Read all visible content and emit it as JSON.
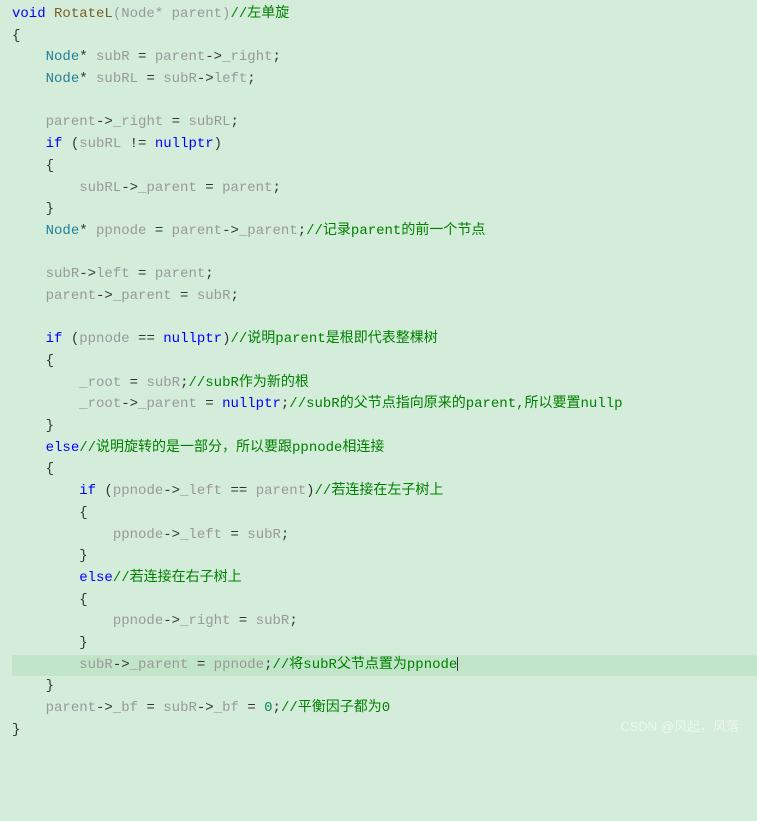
{
  "watermark": "CSDN @风起，风落",
  "tokens": {
    "void": "void",
    "Node": "Node",
    "if": "if",
    "else": "else",
    "nullptr": "nullptr"
  },
  "code": {
    "l1_func": "RotateL",
    "l1_params": "(Node* parent)",
    "l1_comment": "//左单旋",
    "l2": "{",
    "l3_prefix": "    ",
    "l3_type": "Node",
    "l3_star": "* ",
    "l3_var": "subR",
    "l3_eq": " = ",
    "l3_rhs1": "parent",
    "l3_arr": "->",
    "l3_rhs2": "_right",
    "l3_semi": ";",
    "l4_var": "subRL",
    "l4_rhs1": "subR",
    "l4_rhs2": "left",
    "l6_lhs1": "parent",
    "l6_lhs2": "_right",
    "l6_rhs": "subRL",
    "l7_cond1": "subRL",
    "l7_cond2": " != ",
    "l9_lhs": "subRL",
    "l9_mem": "_parent",
    "l9_rhs": "parent",
    "l11_var": "ppnode",
    "l11_rhs1": "parent",
    "l11_rhs2": "_parent",
    "l11_comment": "//记录parent的前一个节点",
    "l13_lhs": "subR",
    "l13_mem": "left",
    "l13_rhs": "parent",
    "l14_lhs": "parent",
    "l14_mem": "_parent",
    "l14_rhs": "subR",
    "l16_cond1": "ppnode",
    "l16_cond2": " == ",
    "l16_comment": "//说明parent是根即代表整棵树",
    "l18_lhs": "_root",
    "l18_rhs": "subR",
    "l18_comment": "//subR作为新的根",
    "l19_lhs": "_root",
    "l19_mem": "_parent",
    "l19_comment": "//subR的父节点指向原来的parent,所以要置nullp",
    "l21_comment": "//说明旋转的是一部分，所以要跟ppnode相连接",
    "l23_cond1": "ppnode",
    "l23_mem": "_left",
    "l23_cond2": " == ",
    "l23_rhs": "parent",
    "l23_comment": "//若连接在左子树上",
    "l25_lhs": "ppnode",
    "l25_mem": "_left",
    "l25_rhs": "subR",
    "l27_comment": "//若连接在右子树上",
    "l29_lhs": "ppnode",
    "l29_mem": "_right",
    "l29_rhs": "subR",
    "l31_lhs": "subR",
    "l31_mem": "_parent",
    "l31_rhs": "ppnode",
    "l31_comment": "//将subR父节点置为ppnode",
    "l33_lhs1": "parent",
    "l33_mem1": "_bf",
    "l33_lhs2": "subR",
    "l33_mem2": "_bf",
    "l33_val": "0",
    "l33_comment": "//平衡因子都为0"
  }
}
